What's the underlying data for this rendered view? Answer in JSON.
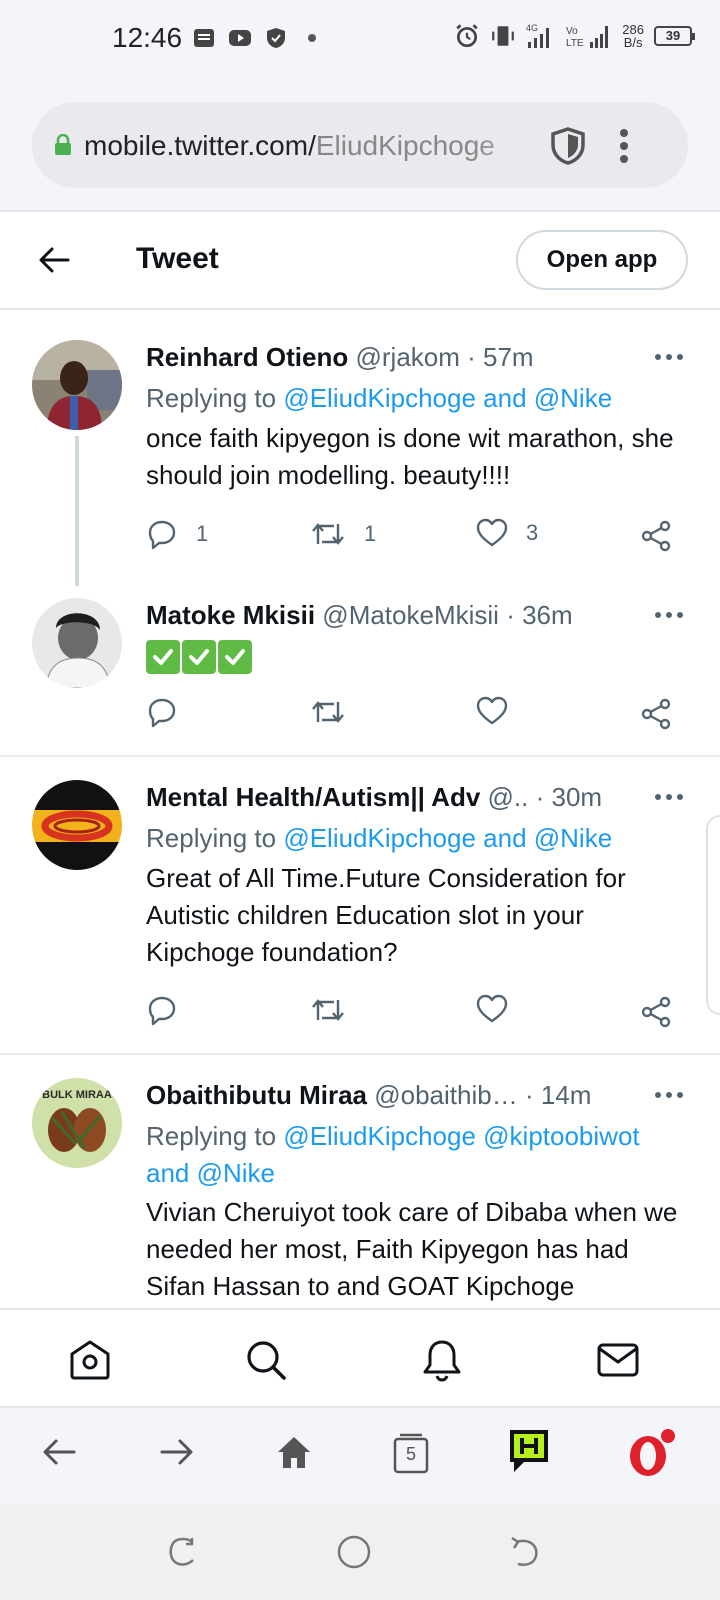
{
  "status_bar": {
    "time": "12:46",
    "speed": "286",
    "speed_unit": "B/s",
    "battery": "39",
    "network_label": "4G",
    "volte_label": "Vo\nLTE"
  },
  "url_bar": {
    "host": "mobile.twitter.com/",
    "path": "EliudKipchoge"
  },
  "header": {
    "title": "Tweet",
    "open_app": "Open app"
  },
  "tweets": [
    {
      "name": "Reinhard Otieno",
      "handle": "@rjakom",
      "time": "· 57m",
      "reply_prefix": "Replying to ",
      "reply_mentions": "@EliudKipchoge and @Nike",
      "reply_mentions_2": "",
      "text": "once faith kipyegon  is done wit marathon, she should join modelling. beauty!!!!",
      "replies": "1",
      "retweets": "1",
      "likes": "3"
    },
    {
      "name": "Matoke Mkisii",
      "handle": "@MatokeMkisii",
      "time": "· 36m",
      "text": "✅✅✅",
      "replies": "",
      "retweets": "",
      "likes": ""
    },
    {
      "name": "Mental Health/Autism|| Adv",
      "handle": "@..",
      "time": "· 30m",
      "reply_prefix": "Replying to ",
      "reply_mentions": "@EliudKipchoge and @Nike",
      "text": "Great of All Time.Future Consideration for Autistic children Education slot in your Kipchoge foundation?",
      "replies": "",
      "retweets": "",
      "likes": ""
    },
    {
      "name": "Obaithibutu Miraa",
      "handle": "@obaithib…",
      "time": "· 14m",
      "reply_prefix": "Replying to ",
      "reply_mentions": "@EliudKipchoge @kiptoobiwot",
      "reply_mentions_2": "and @Nike",
      "avatar_text": "BULK MIRAA",
      "text": "Vivian Cheruiyot took care of Dibaba when we needed her most, Faith Kipyegon has had Sifan Hassan to and GOAT Kipchoge"
    }
  ],
  "bottom_nav": {
    "items": [
      "home-icon",
      "search-icon",
      "notifications-icon",
      "messages-icon"
    ]
  },
  "browser_bar": {
    "tabs_count": "5"
  },
  "colors": {
    "accent": "#1d9bf0",
    "muted": "#536471",
    "text": "#0f1419",
    "opera_red": "#e0202a",
    "check_green": "#5fba46"
  }
}
